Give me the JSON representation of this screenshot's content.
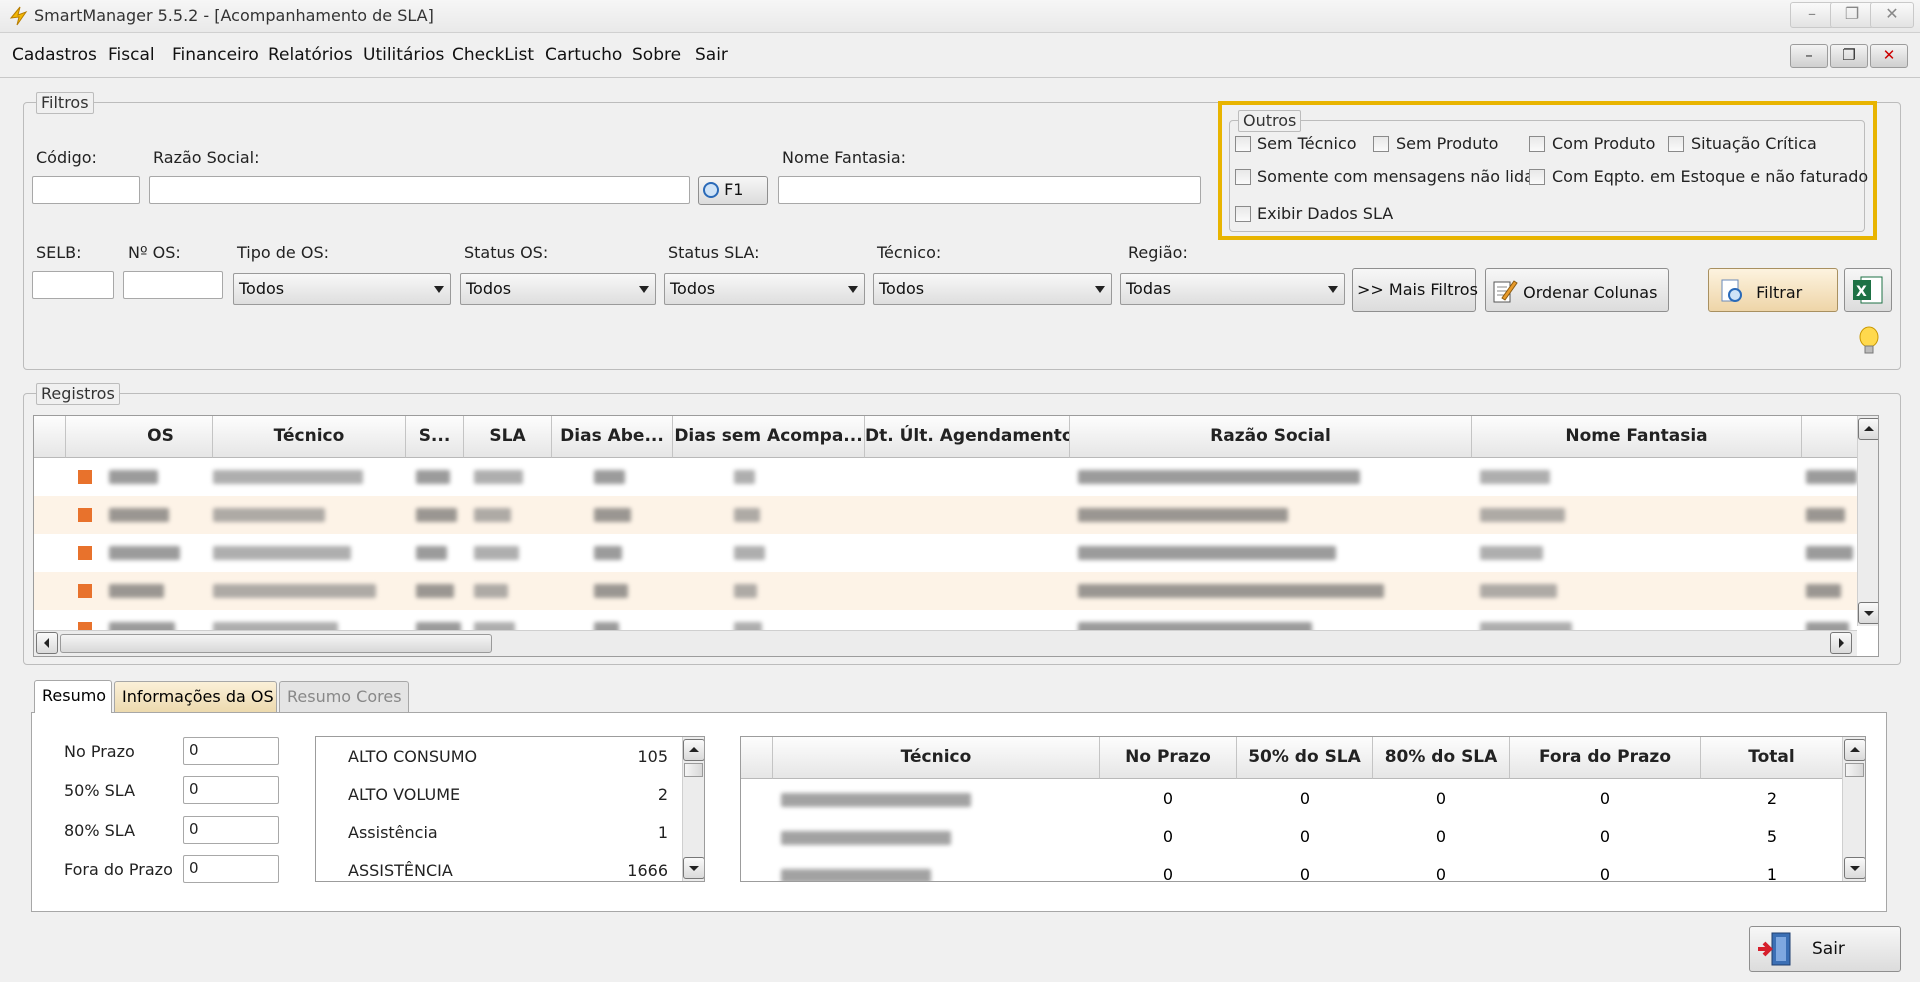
{
  "window": {
    "title": "SmartManager 5.5.2 - [Acompanhamento de SLA]"
  },
  "menu": [
    "Cadastros",
    "Fiscal",
    "Financeiro",
    "Relatórios",
    "Utilitários",
    "CheckList",
    "Cartucho",
    "Sobre",
    "Sair"
  ],
  "filtros": {
    "legend": "Filtros",
    "codigo_label": "Código:",
    "razao_label": "Razão Social:",
    "f1_label": "F1",
    "nome_fantasia_label": "Nome Fantasia:",
    "selb_label": "SELB:",
    "nos_label": "Nº OS:",
    "tipo_os": {
      "label": "Tipo de OS:",
      "value": "Todos"
    },
    "status_os": {
      "label": "Status OS:",
      "value": "Todos"
    },
    "status_sla": {
      "label": "Status SLA:",
      "value": "Todos"
    },
    "tecnico": {
      "label": "Técnico:",
      "value": "Todos"
    },
    "regiao": {
      "label": "Região:",
      "value": "Todas"
    },
    "mais_filtros": ">> Mais Filtros",
    "ordenar_colunas": "Ordenar Colunas",
    "filtrar": "Filtrar"
  },
  "outros": {
    "legend": "Outros",
    "sem_tecnico": "Sem Técnico",
    "sem_produto": "Sem Produto",
    "com_produto": "Com Produto",
    "situacao_critica": "Situação Crítica",
    "somente_msgs": "Somente com mensagens não lidas",
    "com_eqpto": "Com Eqpto. em Estoque e não faturado",
    "exibir_sla": "Exibir Dados SLA",
    "highlight_color": "#e8b400"
  },
  "registros": {
    "legend": "Registros",
    "columns": [
      "OS",
      "Técnico",
      "S...",
      "SLA",
      "Dias Abe...",
      "Dias sem Acompa...",
      "Dt. Últ. Agendamento",
      "Razão Social",
      "Nome Fantasia"
    ],
    "row_marker_color": "#e8722c"
  },
  "tabs": [
    "Resumo",
    "Informações da OS",
    "Resumo Cores"
  ],
  "resumo": {
    "no_prazo": {
      "label": "No Prazo",
      "value": "0"
    },
    "sla50": {
      "label": "50% SLA",
      "value": "0"
    },
    "sla80": {
      "label": "80% SLA",
      "value": "0"
    },
    "fora_prazo": {
      "label": "Fora do Prazo",
      "value": "0"
    }
  },
  "categorias": [
    {
      "name": "ALTO CONSUMO",
      "count": "105"
    },
    {
      "name": "ALTO VOLUME",
      "count": "2"
    },
    {
      "name": "Assistência",
      "count": "1"
    },
    {
      "name": "ASSISTÊNCIA",
      "count": "1666"
    }
  ],
  "tecnico_table": {
    "columns": [
      "Técnico",
      "No Prazo",
      "50% do SLA",
      "80% do SLA",
      "Fora do Prazo",
      "Total"
    ],
    "rows": [
      [
        "0",
        "0",
        "0",
        "0",
        "2"
      ],
      [
        "0",
        "0",
        "0",
        "0",
        "5"
      ],
      [
        "0",
        "0",
        "0",
        "0",
        "1"
      ]
    ]
  },
  "sair_label": "Sair"
}
